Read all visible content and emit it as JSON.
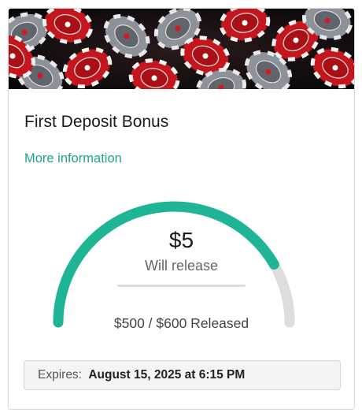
{
  "bonus": {
    "title": "First Deposit Bonus",
    "more_info_label": "More information",
    "amount": "$5",
    "amount_label": "Will release",
    "released_text": "$500 / $600 Released",
    "released_value": 500,
    "target_value": 600,
    "expires_label": "Expires:",
    "expires_value": "August 15, 2025 at 6:15 PM"
  },
  "banner": {
    "image": "poker-chips-image"
  },
  "colors": {
    "accent": "#1db595",
    "gauge_track": "#dddddd",
    "link": "#1ea68a",
    "chip_red": "#d21a20",
    "chip_gray": "#9aa0a6"
  }
}
